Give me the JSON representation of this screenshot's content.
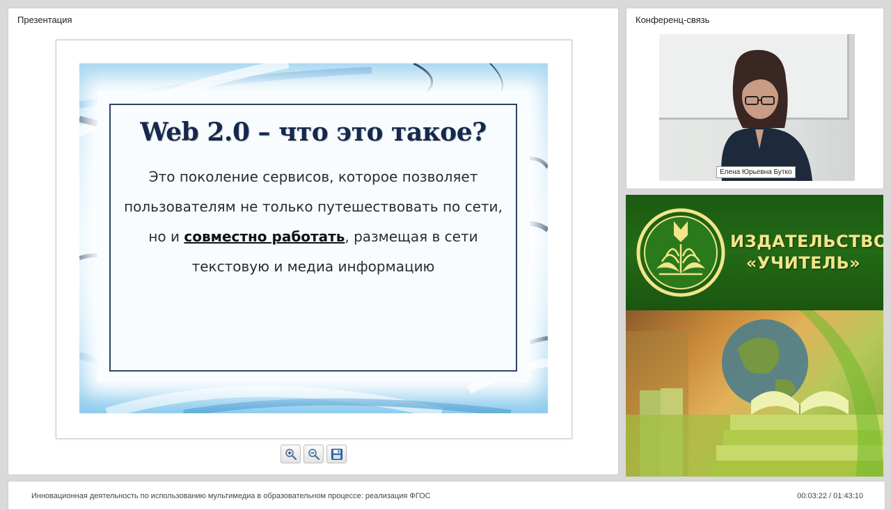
{
  "presentation": {
    "panel_title": "Презентация",
    "slide": {
      "title": "Web 2.0 – что это такое?",
      "body_before": "Это поколение сервисов, которое позволяет пользователям не только путешествовать по сети, но и ",
      "body_emphasis": "совместно работать",
      "body_after": ", размещая в сети текстовую и медиа информацию"
    },
    "toolbar": [
      {
        "name": "zoom-in-button",
        "icon": "zoom-in-icon"
      },
      {
        "name": "zoom-out-button",
        "icon": "zoom-out-icon"
      },
      {
        "name": "save-button",
        "icon": "floppy-disk-icon"
      }
    ]
  },
  "conference": {
    "panel_title": "Конференц-связь",
    "speaker_name": "Елена Юрьевна Бутко"
  },
  "publisher": {
    "name_line1": "ИЗДАТЕЛЬСТВО",
    "name_line2": "«УЧИТЕЛЬ»",
    "colors": {
      "green": "#226a16",
      "gold": "#f2e58a"
    }
  },
  "footer": {
    "lecture_title": "Инновационная деятельность по использованию мультимедиа в образовательном процессе: реализация ФГОС",
    "time_current": "00:03:22",
    "time_separator": " / ",
    "time_total": "01:43:10"
  }
}
